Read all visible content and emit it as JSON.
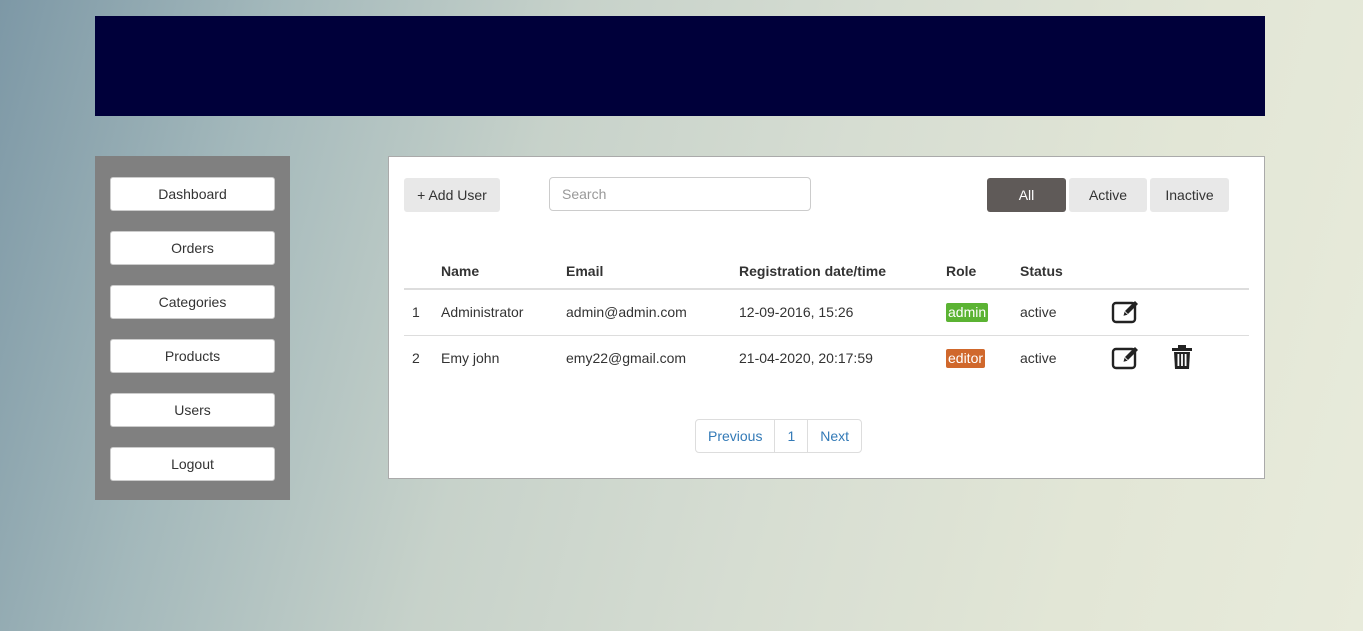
{
  "sidebar": {
    "items": [
      {
        "label": "Dashboard"
      },
      {
        "label": "Orders"
      },
      {
        "label": "Categories"
      },
      {
        "label": "Products"
      },
      {
        "label": "Users"
      },
      {
        "label": "Logout"
      }
    ]
  },
  "toolbar": {
    "add_label": "+ Add User",
    "search_placeholder": "Search",
    "filters": {
      "all": "All",
      "active": "Active",
      "inactive": "Inactive"
    },
    "selected_filter": "All"
  },
  "table": {
    "headers": {
      "num": "",
      "name": "Name",
      "email": "Email",
      "date": "Registration date/time",
      "role": "Role",
      "status": "Status"
    },
    "rows": [
      {
        "num": "1",
        "name": "Administrator",
        "email": "admin@admin.com",
        "date": "12-09-2016, 15:26",
        "role": "admin",
        "role_color": "#5bb333",
        "status": "active",
        "actions": [
          "edit-icon"
        ]
      },
      {
        "num": "2",
        "name": "Emy john",
        "email": "emy22@gmail.com",
        "date": "21-04-2020, 20:17:59",
        "role": "editor",
        "role_color": "#d0682c",
        "status": "active",
        "actions": [
          "edit-icon",
          "trash-icon"
        ]
      }
    ]
  },
  "pagination": {
    "previous": "Previous",
    "page": "1",
    "next": "Next"
  },
  "colors": {
    "banner": "#00003a",
    "sidebar": "#808080",
    "selected_filter": "#5f5a58",
    "link": "#337ab7"
  }
}
